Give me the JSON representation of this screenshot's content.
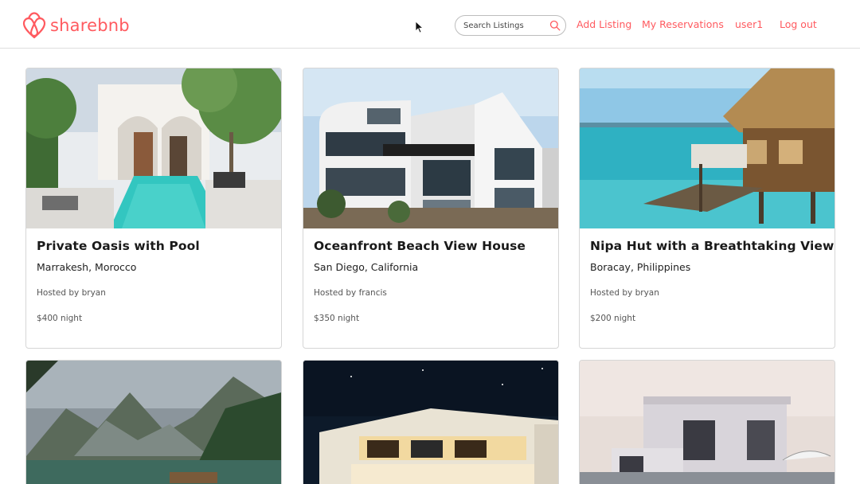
{
  "brand": {
    "name": "sharebnb",
    "color": "#ff5a5f",
    "logo_icon": "airbnb-belo-icon"
  },
  "nav": {
    "search_placeholder": "Search Listings",
    "search_icon": "search-icon",
    "links": {
      "add_listing": "Add Listing",
      "my_reservations": "My Reservations",
      "user": "user1",
      "logout": "Log out"
    }
  },
  "listings": [
    {
      "title": "Private Oasis with Pool",
      "location": "Marrakesh, Morocco",
      "host": "Hosted by bryan",
      "price": "$400 night"
    },
    {
      "title": "Oceanfront Beach View House",
      "location": "San Diego, California",
      "host": "Hosted by francis",
      "price": "$350 night"
    },
    {
      "title": "Nipa Hut with a Breathtaking View",
      "location": "Boracay, Philippines",
      "host": "Hosted by bryan",
      "price": "$200 night"
    }
  ],
  "colors": {
    "accent": "#ff5a5f",
    "border": "#d6d6d6"
  }
}
